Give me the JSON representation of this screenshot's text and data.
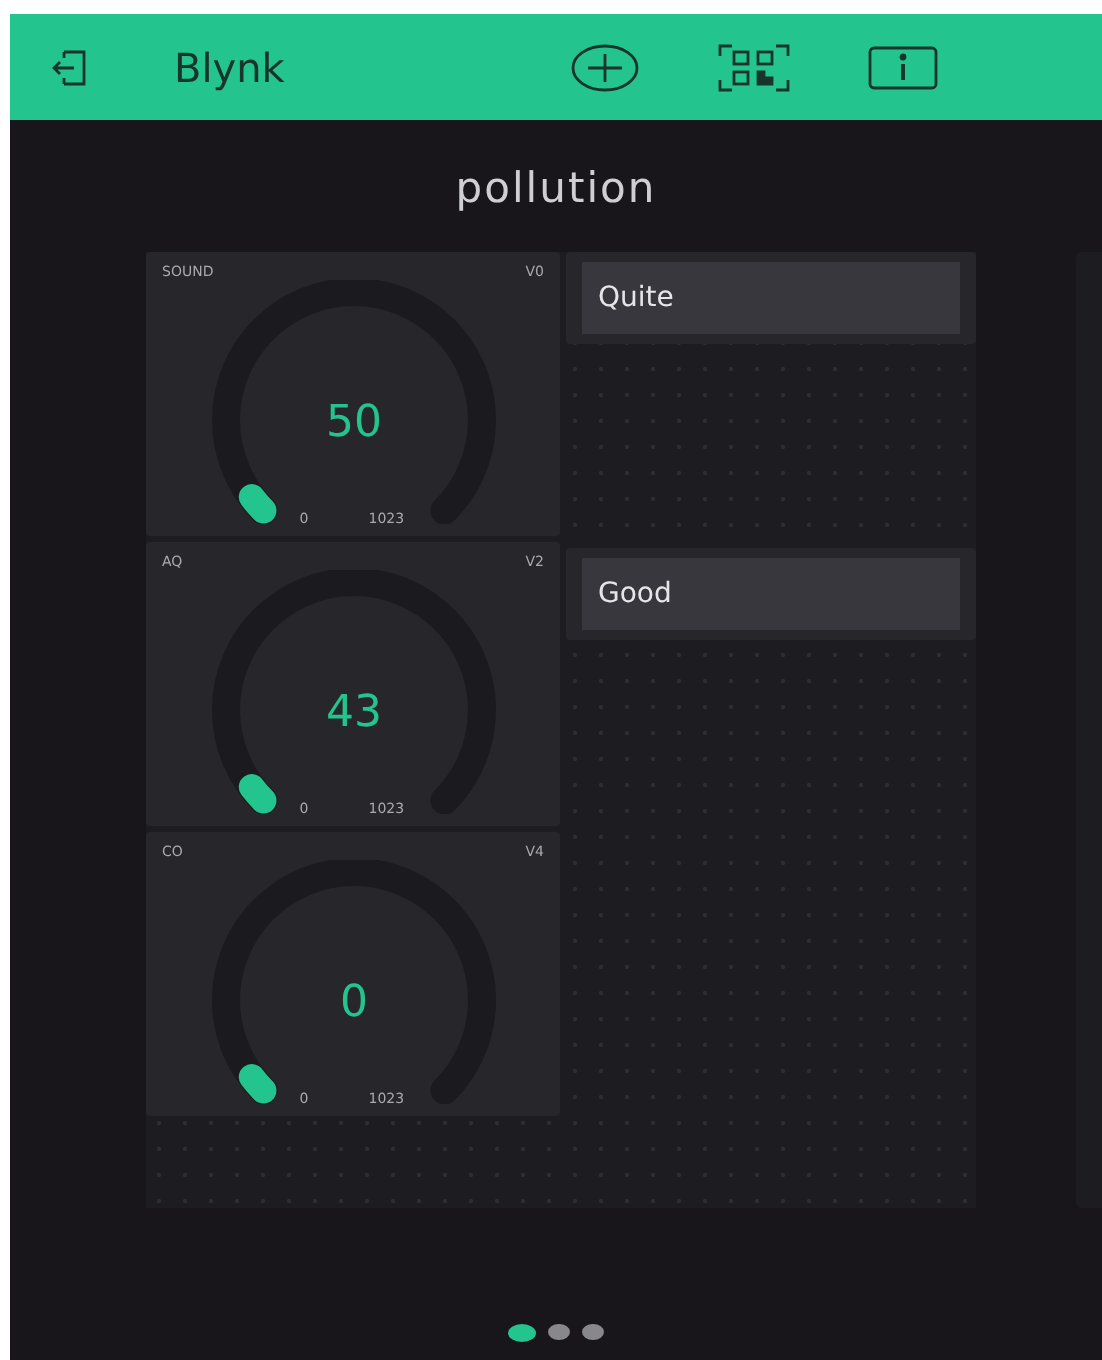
{
  "header": {
    "title": "Blynk"
  },
  "dashboard": {
    "title": "pollution"
  },
  "gauges": [
    {
      "label": "SOUND",
      "pin": "V0",
      "value": "50",
      "min": "0",
      "max": "1023"
    },
    {
      "label": "AQ",
      "pin": "V2",
      "value": "43",
      "min": "0",
      "max": "1023"
    },
    {
      "label": "CO",
      "pin": "V4",
      "value": "0",
      "min": "0",
      "max": "1023"
    }
  ],
  "displays": [
    {
      "text": "Quite"
    },
    {
      "text": "Good"
    }
  ],
  "pages": [
    {
      "selected": true
    },
    {
      "selected": false
    },
    {
      "selected": false
    }
  ]
}
